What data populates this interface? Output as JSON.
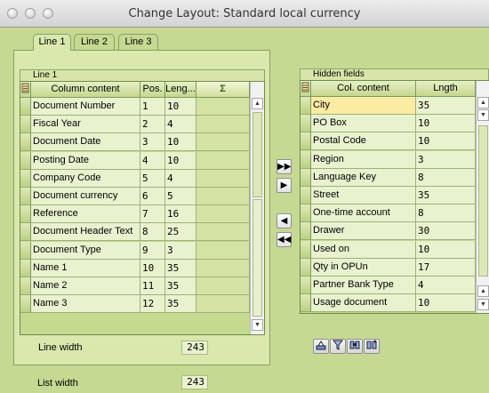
{
  "window": {
    "title": "Change Layout: Standard local currency"
  },
  "tabs": [
    {
      "label": "Line 1",
      "active": true
    },
    {
      "label": "Line 2",
      "active": false
    },
    {
      "label": "Line 3",
      "active": false
    }
  ],
  "line_table": {
    "group_title": "Line 1",
    "headers": {
      "content": "Column content",
      "pos": "Pos.",
      "length": "Leng...",
      "sum": "Σ"
    },
    "rows": [
      {
        "content": "Document Number",
        "pos": "1",
        "length": "10"
      },
      {
        "content": "Fiscal Year",
        "pos": "2",
        "length": "4"
      },
      {
        "content": "Document Date",
        "pos": "3",
        "length": "10"
      },
      {
        "content": "Posting Date",
        "pos": "4",
        "length": "10"
      },
      {
        "content": "Company Code",
        "pos": "5",
        "length": "4"
      },
      {
        "content": "Document currency",
        "pos": "6",
        "length": "5"
      },
      {
        "content": "Reference",
        "pos": "7",
        "length": "16"
      },
      {
        "content": "Document Header Text",
        "pos": "8",
        "length": "25"
      },
      {
        "content": "Document Type",
        "pos": "9",
        "length": "3"
      },
      {
        "content": "Name 1",
        "pos": "10",
        "length": "35"
      },
      {
        "content": "Name 2",
        "pos": "11",
        "length": "35"
      },
      {
        "content": "Name 3",
        "pos": "12",
        "length": "35"
      }
    ]
  },
  "hidden_table": {
    "group_title": "Hidden fields",
    "headers": {
      "content": "Col. content",
      "length": "Lngth"
    },
    "rows": [
      {
        "content": "City",
        "length": "35"
      },
      {
        "content": "PO Box",
        "length": "10"
      },
      {
        "content": "Postal Code",
        "length": "10"
      },
      {
        "content": "Region",
        "length": "3"
      },
      {
        "content": "Language Key",
        "length": "8"
      },
      {
        "content": "Street",
        "length": "35"
      },
      {
        "content": "One-time account",
        "length": "8"
      },
      {
        "content": "Drawer",
        "length": "30"
      },
      {
        "content": "Used on",
        "length": "10"
      },
      {
        "content": "Qty in OPUn",
        "length": "17"
      },
      {
        "content": "Partner Bank Type",
        "length": "4"
      },
      {
        "content": "Usage document",
        "length": "10"
      }
    ]
  },
  "move_buttons": {
    "all_right": "▶▶",
    "right": "▶",
    "left": "◀",
    "all_left": "◀◀"
  },
  "line_width": {
    "label": "Line width",
    "value": "243"
  },
  "list_width": {
    "label": "List width",
    "value": "243"
  },
  "icons": [
    "ok-icon",
    "filter-icon",
    "find-icon",
    "find-next-icon"
  ],
  "colors": {
    "background": "#c6d992",
    "cell": "#e9f2cf",
    "selected_cell": "#fbeba3"
  }
}
